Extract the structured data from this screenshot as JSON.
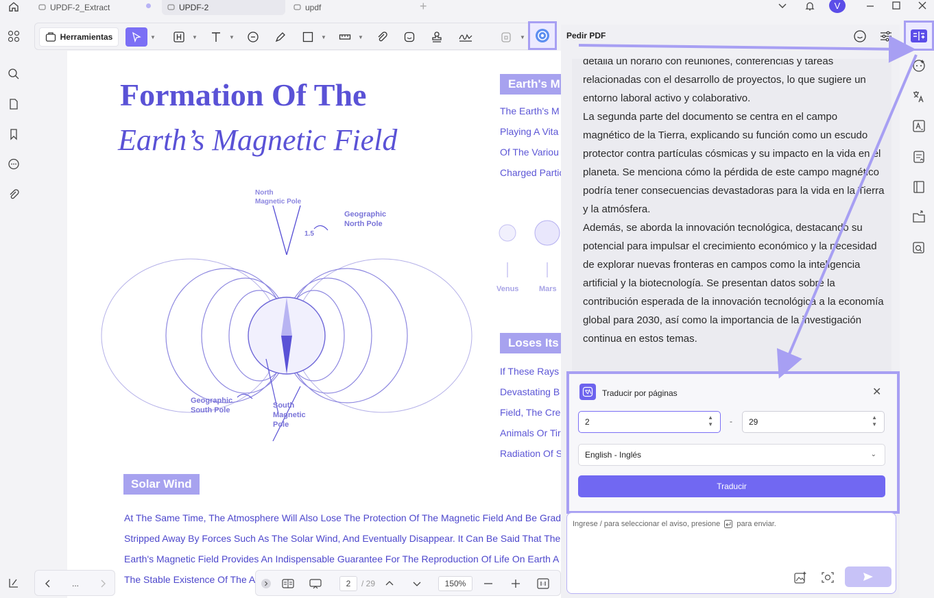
{
  "tabs": [
    {
      "label": "UPDF-2_Extract"
    },
    {
      "label": "UPDF-2"
    },
    {
      "label": "updf"
    }
  ],
  "user": {
    "avatar_letter": "V"
  },
  "toolbar": {
    "tools_label": "Herramientas"
  },
  "document": {
    "title_line1": "Formation Of The",
    "title_line2": "Earth’s Magnetic Field",
    "section_earth": "Earth's M",
    "earth_links": [
      "The Earth's M",
      "Playing A Vita",
      "Of The Variou",
      "Charged Partic"
    ],
    "planets": [
      "Venus",
      "Mars"
    ],
    "section_loses": "Loses Its I",
    "loses_links": [
      "If These Rays",
      "Devastating B",
      "Field, The Cre",
      "Animals Or Tir",
      "Radiation Of S"
    ],
    "diagram_labels": {
      "north_magnetic": [
        "North",
        "Magnetic Pole"
      ],
      "geographic_north": [
        "Geographic",
        "North Pole"
      ],
      "angle": "1.5",
      "geographic_south": [
        "Geographic",
        "South Pole"
      ],
      "south_magnetic": [
        "South",
        "Magnetic",
        "Pole"
      ]
    },
    "solar_wind_heading": "Solar Wind",
    "solar_lines": [
      "At The Same Time, The Atmosphere Will Also Lose The Protection Of The Magnetic Field And Be Grad",
      "Stripped Away By Forces Such As The Solar Wind, And Eventually Disappear. It Can Be Said That The",
      "Earth's Magnetic Field Provides An Indispensable Guarantee For The Reproduction Of Life On Earth A",
      "The Stable Existence Of The A"
    ]
  },
  "bottombar": {
    "page_nav_dots": "...",
    "current_page": "2",
    "total_pages": "/ 29",
    "zoom": "150%"
  },
  "panel": {
    "title": "Pedir PDF",
    "chat_paragraphs": [
      "detalla un horario con reuniones, conferencias y tareas relacionadas con el desarrollo de proyectos, lo que sugiere un entorno laboral activo y colaborativo.",
      "La segunda parte del documento se centra en el campo magnético de la Tierra, explicando su función como un escudo protector contra partículas cósmicas y su impacto en la vida en el planeta. Se menciona cómo la pérdida de este campo magnético podría tener consecuencias devastadoras para la vida en la Tierra y la atmósfera.",
      "Además, se aborda la innovación tecnológica, destacando su potencial para impulsar el crecimiento económico y la necesidad de explorar nuevas fronteras en campos como la inteligencia artificial y la biotecnología. Se presentan datos sobre la contribución esperada de la innovación tecnológica a la economía global para 2030, así como la importancia de la investigación continua en estos temas."
    ],
    "translate": {
      "title": "Traducir por páginas",
      "from_page": "2",
      "to_page": "29",
      "separator": "-",
      "language": "English - Inglés",
      "button": "Traducir"
    },
    "input_placeholder_before": "Ingrese / para seleccionar el aviso, presione",
    "input_placeholder_after": "para enviar."
  },
  "colors": {
    "accent": "#7168f2",
    "highlight_border": "#a79ff3",
    "doc_title": "#5a52d6"
  }
}
